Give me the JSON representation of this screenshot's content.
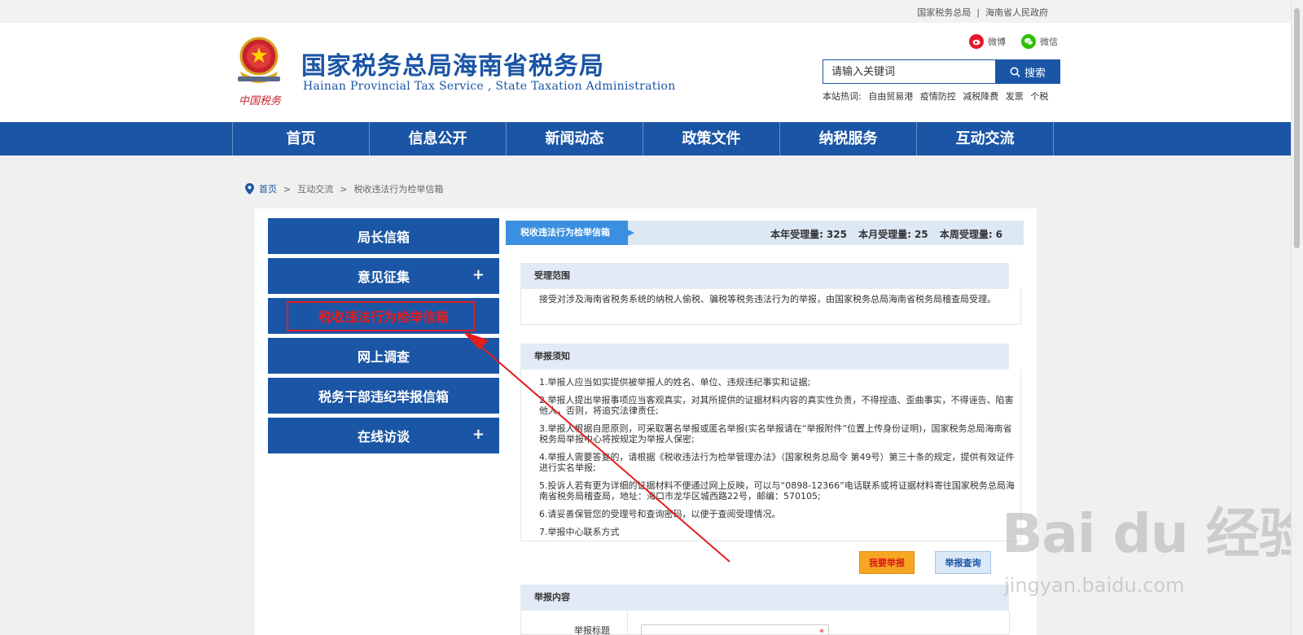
{
  "topbar": {
    "link1": "国家税务总局",
    "separator": "|",
    "link2": "海南省人民政府"
  },
  "header": {
    "title_cn": "国家税务总局海南省税务局",
    "title_en": "Hainan Provincial Tax Service , State Taxation Administration",
    "logo_text": "中国税务",
    "weibo": "微博",
    "wechat": "微信",
    "search_placeholder": "请输入关键词",
    "search_button": "搜索",
    "hot_label": "本站热词:",
    "hot_words": [
      "自由贸易港",
      "疫情防控",
      "减税降费",
      "发票",
      "个税"
    ]
  },
  "nav": [
    "首页",
    "信息公开",
    "新闻动态",
    "政策文件",
    "纳税服务",
    "互动交流"
  ],
  "breadcrumb": {
    "home": "首页",
    "sep": ">",
    "level2": "互动交流",
    "current": "税收违法行为检举信箱"
  },
  "sidebar": [
    {
      "label": "局长信箱",
      "plus": ""
    },
    {
      "label": "意见征集",
      "plus": "+"
    },
    {
      "label": "税收违法行为检举信箱",
      "plus": ""
    },
    {
      "label": "网上调查",
      "plus": ""
    },
    {
      "label": "税务干部违纪举报信箱",
      "plus": ""
    },
    {
      "label": "在线访谈",
      "plus": "+"
    }
  ],
  "title_bar": {
    "tab": "税收违法行为检举信箱",
    "year_label": "本年受理量:",
    "year_value": "325",
    "month_label": "本月受理量:",
    "month_value": "25",
    "week_label": "本周受理量:",
    "week_value": "6"
  },
  "scope": {
    "heading": "受理范围",
    "text": "接受对涉及海南省税务系统的纳税人偷税、骗税等税务违法行为的举报，由国家税务总局海南省税务局稽查局受理。"
  },
  "notice": {
    "heading": "举报须知",
    "items": [
      "1.举报人应当如实提供被举报人的姓名、单位、违规违纪事实和证据;",
      "2.举报人提出举报事项应当客观真实，对其所提供的证据材料内容的真实性负责，不得捏造、歪曲事实，不得诬告、陷害他人，否则，将追究法律责任;",
      "3.举报人根据自愿原则，可采取署名举报或匿名举报(实名举报请在“举报附件”位置上传身份证明)，国家税务总局海南省税务局举报中心将按规定为举报人保密;",
      "4.举报人需要答复的，请根据《税收违法行为检举管理办法》（国家税务总局令 第49号）第三十条的规定，提供有效证件进行实名举报;",
      "5.投诉人若有更为详细的证据材料不便通过网上反映，可以与“0898-12366”电话联系或将证据材料寄往国家税务总局海南省税务局稽查局，地址：海口市龙华区城西路22号，邮编：570105;",
      "6.请妥善保管您的受理号和查询密码，以便于查阅受理情况。",
      "7.举报中心联系方式"
    ]
  },
  "buttons": {
    "report": "我要举报",
    "query": "举报查询"
  },
  "form": {
    "heading": "举报内容",
    "title_label": "举报标题",
    "required_mark": "*"
  },
  "watermark": {
    "logo": "Bai du 经验",
    "url": "jingyan.baidu.com"
  },
  "colors": {
    "brand_blue": "#1b55a5",
    "highlight_red": "#e51d1d",
    "tab_blue": "#3a8fe0",
    "report_orange": "#f7a623"
  }
}
